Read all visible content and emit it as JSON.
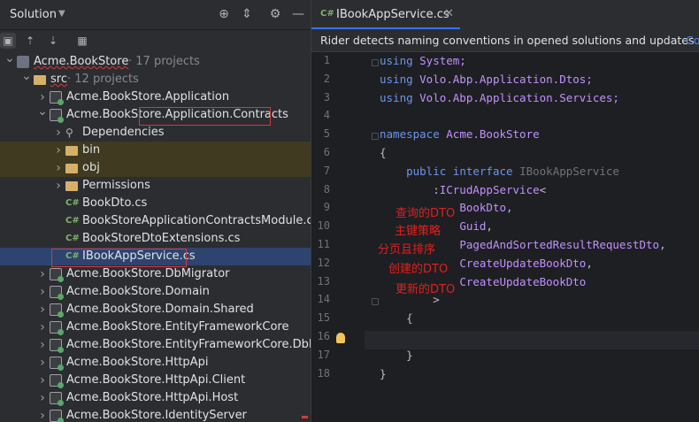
{
  "left_panel": {
    "title": "Solution",
    "header_icons": [
      "crosshair-icon",
      "collapse-all-icon",
      "settings-icon",
      "minimize-icon"
    ],
    "toolbar_icons": [
      "pin-icon",
      "collapse-icon",
      "preview-icon",
      "show-panel-icon"
    ],
    "tree": [
      {
        "label": "Acme.BookStore",
        "suffix": " · 17 projects",
        "icon": "solution-icon",
        "indent": 0,
        "arrow": "down",
        "underline": true
      },
      {
        "label": "src",
        "suffix": " · 12 projects",
        "icon": "folder-icon",
        "indent": 1,
        "arrow": "down",
        "underline": true
      },
      {
        "label": "Acme.BookStore.Application",
        "icon": "project-icon",
        "indent": 2,
        "arrow": "right"
      },
      {
        "label": "Acme.BookStore.Application.Contracts",
        "icon": "project-icon",
        "indent": 2,
        "arrow": "down"
      },
      {
        "label": "Dependencies",
        "icon": "dependencies-icon",
        "indent": 3,
        "arrow": "right"
      },
      {
        "label": "bin",
        "icon": "folder-icon",
        "indent": 3,
        "arrow": "right",
        "highlight": true
      },
      {
        "label": "obj",
        "icon": "folder-icon",
        "indent": 3,
        "arrow": "right",
        "highlight": true
      },
      {
        "label": "Permissions",
        "icon": "folder-icon",
        "indent": 3,
        "arrow": "right"
      },
      {
        "label": "BookDto.cs",
        "icon": "csharp-icon",
        "indent": 3,
        "arrow": ""
      },
      {
        "label": "BookStoreApplicationContractsModule.cs",
        "icon": "csharp-icon",
        "indent": 3,
        "arrow": ""
      },
      {
        "label": "BookStoreDtoExtensions.cs",
        "icon": "csharp-icon",
        "indent": 3,
        "arrow": ""
      },
      {
        "label": "IBookAppService.cs",
        "icon": "csharp-icon",
        "indent": 3,
        "arrow": "",
        "selected": true
      },
      {
        "label": "Acme.BookStore.DbMigrator",
        "icon": "project-icon",
        "indent": 2,
        "arrow": "right"
      },
      {
        "label": "Acme.BookStore.Domain",
        "icon": "project-icon",
        "indent": 2,
        "arrow": "right"
      },
      {
        "label": "Acme.BookStore.Domain.Shared",
        "icon": "project-icon",
        "indent": 2,
        "arrow": "right"
      },
      {
        "label": "Acme.BookStore.EntityFrameworkCore",
        "icon": "project-icon",
        "indent": 2,
        "arrow": "right"
      },
      {
        "label": "Acme.BookStore.EntityFrameworkCore.DbMigrations",
        "icon": "project-icon",
        "indent": 2,
        "arrow": "right"
      },
      {
        "label": "Acme.BookStore.HttpApi",
        "icon": "project-icon",
        "indent": 2,
        "arrow": "right"
      },
      {
        "label": "Acme.BookStore.HttpApi.Client",
        "icon": "project-icon",
        "indent": 2,
        "arrow": "right"
      },
      {
        "label": "Acme.BookStore.HttpApi.Host",
        "icon": "project-icon",
        "indent": 2,
        "arrow": "right"
      },
      {
        "label": "Acme.BookStore.IdentityServer",
        "icon": "project-icon",
        "indent": 2,
        "arrow": "right"
      }
    ]
  },
  "editor": {
    "tab": {
      "icon_text": "C#",
      "label": "IBookAppService.cs",
      "close": "✕"
    },
    "banner": {
      "text": "Rider detects naming conventions in opened solutions and updates",
      "link": "Co"
    },
    "line_numbers": [
      "1",
      "2",
      "3",
      "4",
      "5",
      "6",
      "7",
      "8",
      "9",
      "10",
      "11",
      "12",
      "13",
      "14",
      "15",
      "16",
      "17",
      "18"
    ],
    "code": [
      [
        {
          "t": "using ",
          "c": "kw"
        },
        {
          "t": "System;",
          "c": "ns"
        }
      ],
      [
        {
          "t": "using ",
          "c": "kw"
        },
        {
          "t": "Volo.Abp.Application.Dtos;",
          "c": "ns"
        }
      ],
      [
        {
          "t": "using ",
          "c": "kw"
        },
        {
          "t": "Volo.Abp.Application.Services;",
          "c": "ns"
        }
      ],
      [],
      [
        {
          "t": "namespace ",
          "c": "kw"
        },
        {
          "t": "Acme.BookStore",
          "c": "ns"
        }
      ],
      [
        {
          "t": "{",
          "c": ""
        }
      ],
      [
        {
          "t": "    public ",
          "c": "kw"
        },
        {
          "t": "interface ",
          "c": "kw"
        },
        {
          "t": "IBookAppService",
          "c": "gray"
        }
      ],
      [
        {
          "t": "        :",
          "c": ""
        },
        {
          "t": "ICrudAppService",
          "c": "typ"
        },
        {
          "t": "<",
          "c": ""
        }
      ],
      [
        {
          "t": "            ",
          "c": ""
        },
        {
          "t": "BookDto",
          "c": "typ"
        },
        {
          "t": ",",
          "c": ""
        }
      ],
      [
        {
          "t": "            ",
          "c": ""
        },
        {
          "t": "Guid",
          "c": "typ"
        },
        {
          "t": ",",
          "c": ""
        }
      ],
      [
        {
          "t": "            ",
          "c": ""
        },
        {
          "t": "PagedAndSortedResultRequestDto",
          "c": "typ"
        },
        {
          "t": ",",
          "c": ""
        }
      ],
      [
        {
          "t": "            ",
          "c": ""
        },
        {
          "t": "CreateUpdateBookDto",
          "c": "typ"
        },
        {
          "t": ",",
          "c": ""
        }
      ],
      [
        {
          "t": "            ",
          "c": ""
        },
        {
          "t": "CreateUpdateBookDto",
          "c": "typ"
        }
      ],
      [
        {
          "t": "        >",
          "c": ""
        }
      ],
      [
        {
          "t": "    {",
          "c": ""
        }
      ],
      [],
      [
        {
          "t": "    }",
          "c": ""
        }
      ],
      [
        {
          "t": "}",
          "c": ""
        }
      ]
    ],
    "annotations": [
      "查询的DTO",
      "主键策略",
      "分页且排序",
      "创建的DTO",
      "更新的DTO"
    ]
  },
  "colors": {
    "annotation": "#e02020",
    "selection": "#2e436e",
    "accent": "#3574f0"
  }
}
